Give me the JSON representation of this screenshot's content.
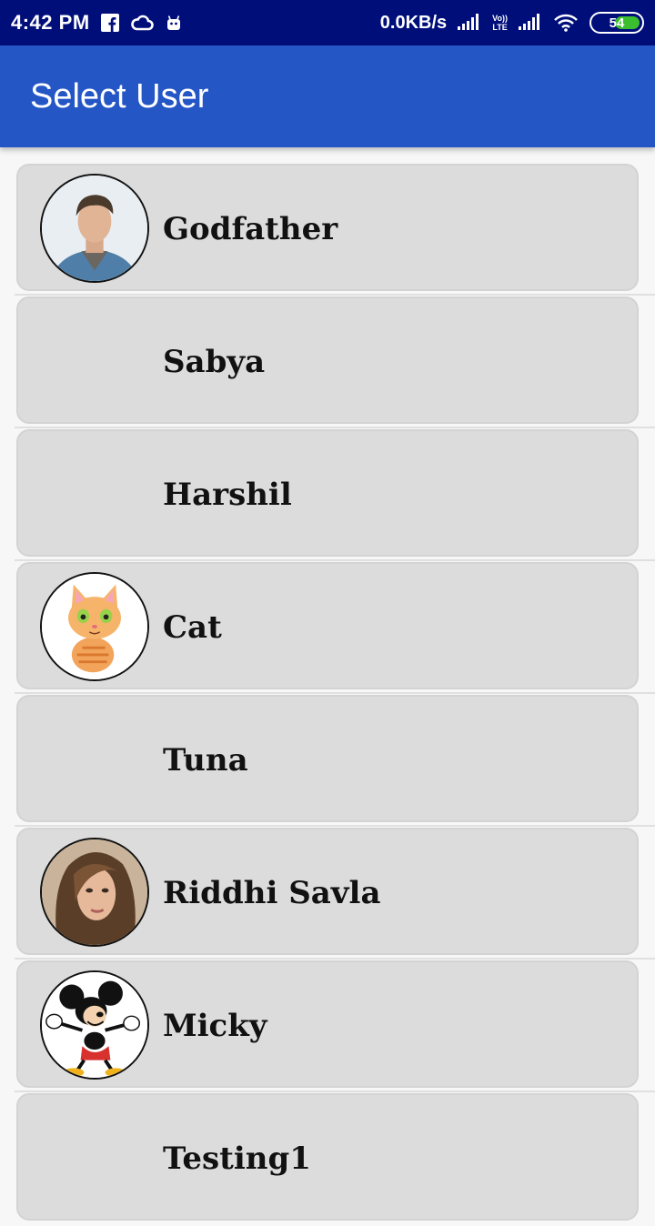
{
  "status_bar": {
    "time": "4:42 PM",
    "network_speed": "0.0KB/s",
    "volte_top": "Vo))",
    "volte_bottom": "LTE",
    "battery_percent": "54",
    "battery_level": 0.54
  },
  "app_bar": {
    "title": "Select User"
  },
  "users": [
    {
      "name": "Godfather",
      "avatar": "man-photo"
    },
    {
      "name": "Sabya",
      "avatar": ""
    },
    {
      "name": "Harshil",
      "avatar": ""
    },
    {
      "name": "Cat",
      "avatar": "cartoon-cat"
    },
    {
      "name": "Tuna",
      "avatar": ""
    },
    {
      "name": "Riddhi Savla",
      "avatar": "woman-photo"
    },
    {
      "name": "Micky",
      "avatar": "mickey-mouse"
    },
    {
      "name": "Testing1",
      "avatar": ""
    }
  ],
  "colors": {
    "status_bar": "#000e7a",
    "app_bar": "#2456c6",
    "card": "#dcdcdc",
    "battery": "#3bbf2e"
  }
}
